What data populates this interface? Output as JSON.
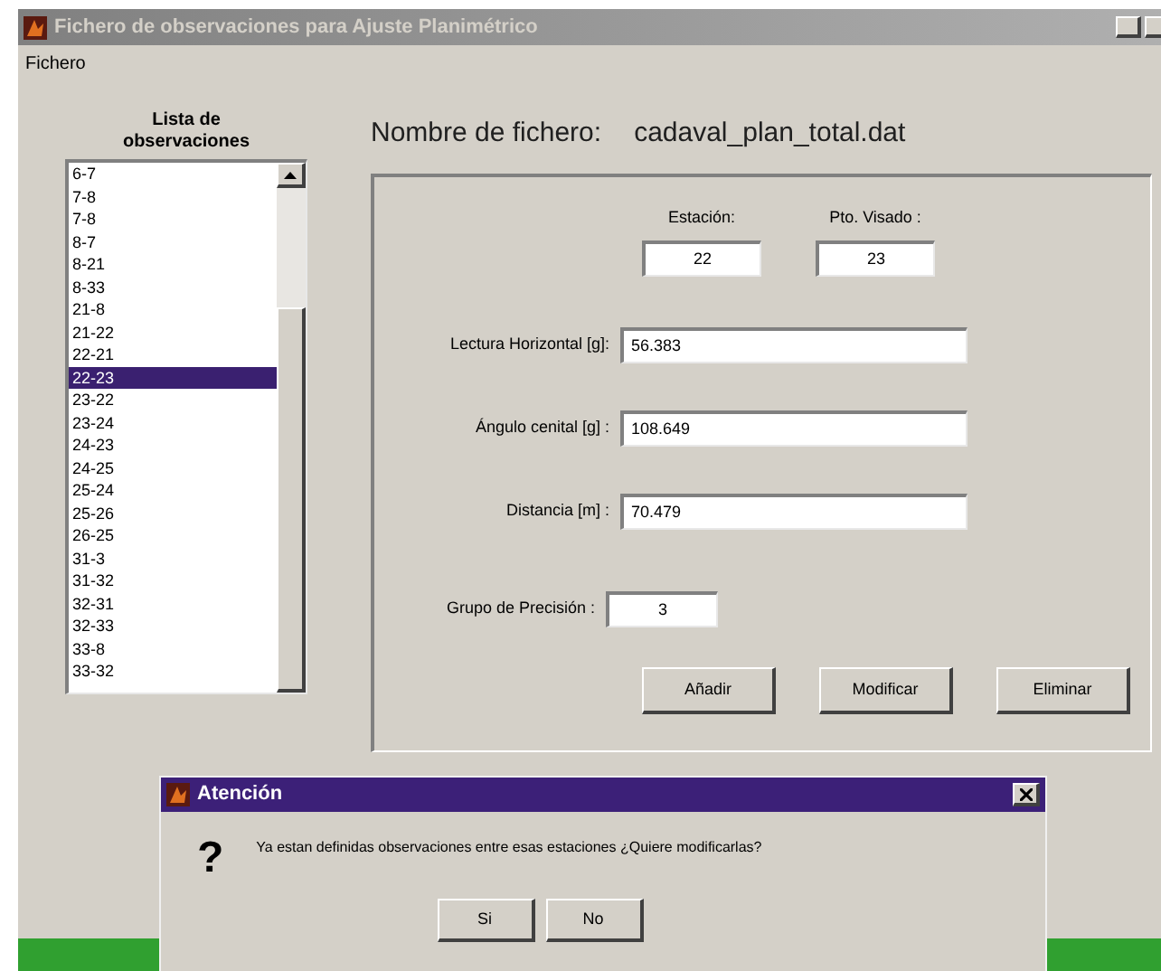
{
  "window": {
    "title": "Fichero de observaciones para Ajuste Planimétrico"
  },
  "menu": [
    "Fichero"
  ],
  "list": {
    "title": "Lista de observaciones",
    "items": [
      {
        "label": "6-7",
        "selected": false
      },
      {
        "label": "7-8",
        "selected": false
      },
      {
        "label": "7-8",
        "selected": false
      },
      {
        "label": "8-7",
        "selected": false
      },
      {
        "label": "8-21",
        "selected": false
      },
      {
        "label": "8-33",
        "selected": false
      },
      {
        "label": "21-8",
        "selected": false
      },
      {
        "label": "21-22",
        "selected": false
      },
      {
        "label": "22-21",
        "selected": false
      },
      {
        "label": "22-23",
        "selected": true
      },
      {
        "label": "23-22",
        "selected": false
      },
      {
        "label": "23-24",
        "selected": false
      },
      {
        "label": "24-23",
        "selected": false
      },
      {
        "label": "24-25",
        "selected": false
      },
      {
        "label": "25-24",
        "selected": false
      },
      {
        "label": "25-26",
        "selected": false
      },
      {
        "label": "26-25",
        "selected": false
      },
      {
        "label": "31-3",
        "selected": false
      },
      {
        "label": "31-32",
        "selected": false
      },
      {
        "label": "32-31",
        "selected": false
      },
      {
        "label": "32-33",
        "selected": false
      },
      {
        "label": "33-8",
        "selected": false
      },
      {
        "label": "33-32",
        "selected": false
      }
    ]
  },
  "file": {
    "label": "Nombre de fichero:",
    "value": "cadaval_plan_total.dat"
  },
  "station": {
    "label": "Estación:",
    "value": "22"
  },
  "target": {
    "label": "Pto. Visado :",
    "value": "23"
  },
  "fields": [
    {
      "label": "Lectura Horizontal [g]:",
      "value": "56.383"
    },
    {
      "label": "Ángulo cenital [g] :",
      "value": "108.649"
    },
    {
      "label": "Distancia [m] :",
      "value": "70.479"
    }
  ],
  "precision": {
    "label": "Grupo de Precisión :",
    "value": "3"
  },
  "buttons": [
    "Añadir",
    "Modificar",
    "Eliminar"
  ],
  "dialog": {
    "title": "Atención",
    "icon": "?",
    "message": "Ya estan definidas observaciones entre esas estaciones ¿Quiere modificarlas?",
    "buttons": [
      "Si",
      "No"
    ]
  }
}
